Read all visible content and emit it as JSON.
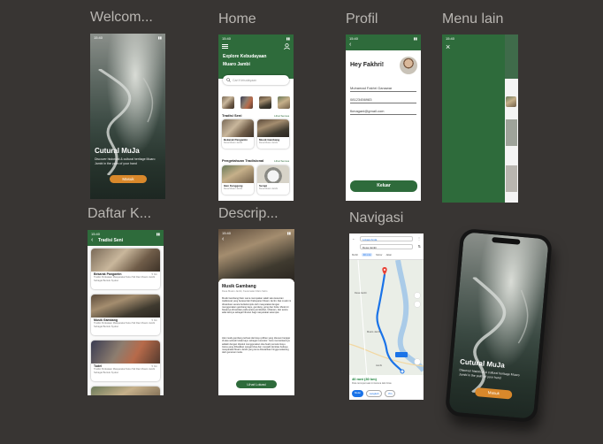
{
  "labels": {
    "welcome": "Welcom...",
    "home": "Home",
    "profil": "Profil",
    "menu_lain": "Menu lain",
    "daftar": "Daftar K...",
    "descrip": "Descrip...",
    "navigasi": "Navigasi"
  },
  "status_time": "15:40",
  "welcome": {
    "title": "Cutural MuJa",
    "subtitle": "Discover historical & cultural heritage Muaro Jambi in the palm of your hand",
    "button": "Masuk"
  },
  "home": {
    "header_line1": "Explore Kebudayaan",
    "header_line2": "Muaro Jambi",
    "search_placeholder": "Cari Kebudayaan",
    "section1_title": "Tradisi Seni",
    "section1_link": "Lihat Semua",
    "section1_cards": [
      {
        "name": "Bekarak Pangantin",
        "sub": "Desa Muaro Jambi"
      },
      {
        "name": "Musik Gambang",
        "sub": "Desa Muaro Jambi"
      }
    ],
    "section2_title": "Pengetahuan Tradisional",
    "section2_link": "Lihat Semua",
    "section2_cards": [
      {
        "name": "Ikan Kenggang",
        "sub": "Desa Muaro Jambi"
      },
      {
        "name": "Serapi",
        "sub": "Desa Muaro Jambi"
      }
    ]
  },
  "profil": {
    "greeting": "Hey Fakhri!",
    "name": "Muhamad Fakhri Ganawar",
    "phone": "08123456983",
    "email": "fkmagani@gmail.com",
    "button": "Keluar"
  },
  "daftar": {
    "title": "Tradisi Seni",
    "items": [
      {
        "name": "Bekarak Pangantin",
        "desc": "Tradisi Perkataan Masyarakat Suku Tali Dan Muaro Jambi Sebagai Bentuk Syukur",
        "meta": "5 bln"
      },
      {
        "name": "Musik Gambang",
        "desc": "Tradisi Perkataan Masyarakat Suku Tali Dan Muaro Jambi Sebagai Bentuk Syukur",
        "meta": "5 bln"
      },
      {
        "name": "Tudel",
        "desc": "Tradisi Perkataan Masyarakat Suku Tali Dan Muaro Jambi Sebagai Bentuk Syukur",
        "meta": "5 bln"
      }
    ]
  },
  "descrip": {
    "title": "Musik Gambang",
    "subtitle": "Desa Muaro Jambi, Kecamatan Maro Sebo",
    "body1": "Musik Gambang Dam Lama merupakan salah satu kesenian tradisional yang berasal dari Kabupaten Muaro Jambi. Alat musik ini dimainkan secara berkelompok oleh masyarakat dengan menggunakan gambang kayu, gendang, gong dan biola. Musik ini biasanya dimainkan pada acara pernikahan, khitanan, dan acara adat lainnya sebagai hiburan bagi masyarakat setempat.",
    "body2": "Alat musik gambang terbuat dari kayu pilihan yang disusun berjajar di atas sebuah kotak kayu sebagai resonator. Cara memainkannya adalah dengan dipukul menggunakan dua buah pemukul kayu. Irama yang dihasilkan sangat khas dan menjadi identitas budaya masyarakat Muaro Jambi yang terus dilestarikan hingga sekarang oleh generasi muda.",
    "button": "Lihat Lokasi"
  },
  "nav": {
    "from": "Lokasi Anda",
    "to": "Desa Jambi",
    "modes": [
      "Mobil",
      "40 mnt",
      "Motor",
      "Jalan"
    ],
    "eta": "40 mnt (30 km)",
    "eta_sub": "Rute tercepat saat ini karena lalu lintas",
    "actions": [
      "Mulai",
      "Langkah",
      "Pin"
    ],
    "places": [
      "Desa Jambi",
      "Muaro Jambi",
      "Jambi"
    ]
  },
  "colors": {
    "background": "#383533",
    "primary_green": "#2e6b3b",
    "accent_orange": "#d9882b",
    "route_blue": "#1a73e8"
  }
}
